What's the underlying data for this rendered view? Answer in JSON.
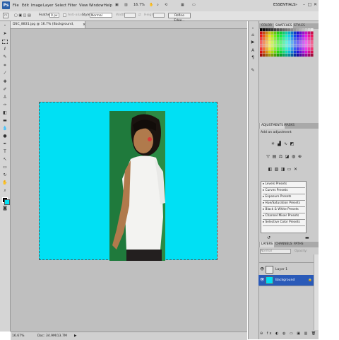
{
  "app": {
    "logo": "Ps"
  },
  "menu": {
    "items": [
      "File",
      "Edit",
      "Image",
      "Layer",
      "Select",
      "Filter",
      "View",
      "Window",
      "Help"
    ]
  },
  "header": {
    "zoom": "16.7%",
    "workspace": "ESSENTIALS",
    "window_buttons": [
      "–",
      "□",
      "✕"
    ]
  },
  "options_bar": {
    "feather_label": "Feather:",
    "feather_value": "0 px",
    "antialias_label": "Anti-alias",
    "style_label": "Style:",
    "style_value": "Normal",
    "width_label": "Width:",
    "height_label": "Height:",
    "refine_edge": "Refine Edge..."
  },
  "document": {
    "tab_title": "DSC_8831.jpg @ 16.7% (Background, RGB/8) *",
    "canvas_color": "#00e0f4",
    "status_zoom": "16.67%",
    "status_doc": "Doc: 34.9M/13.7M"
  },
  "panels": {
    "color_tabs": [
      "COLOR",
      "SWATCHES",
      "STYLES"
    ],
    "adjustment_tabs": [
      "ADJUSTMENTS",
      "MASKS"
    ],
    "add_adjustment": "Add an adjustment",
    "presets": [
      "Levels Presets",
      "Curves Presets",
      "Exposure Presets",
      "Hue/Saturation Presets",
      "Black & White Presets",
      "Channel Mixer Presets",
      "Selective Color Presets"
    ],
    "layers_tabs": [
      "LAYERS",
      "CHANNELS",
      "PATHS"
    ],
    "blend_mode": "Normal",
    "opacity_label": "Opacity:",
    "layers": [
      {
        "name": "Layer 1",
        "selected": false
      },
      {
        "name": "Background",
        "selected": true
      }
    ]
  },
  "colors": {
    "accent_selected": "#2a5ab8",
    "canvas": "#00e0f4",
    "photo_bg": "#1f7a3c"
  }
}
